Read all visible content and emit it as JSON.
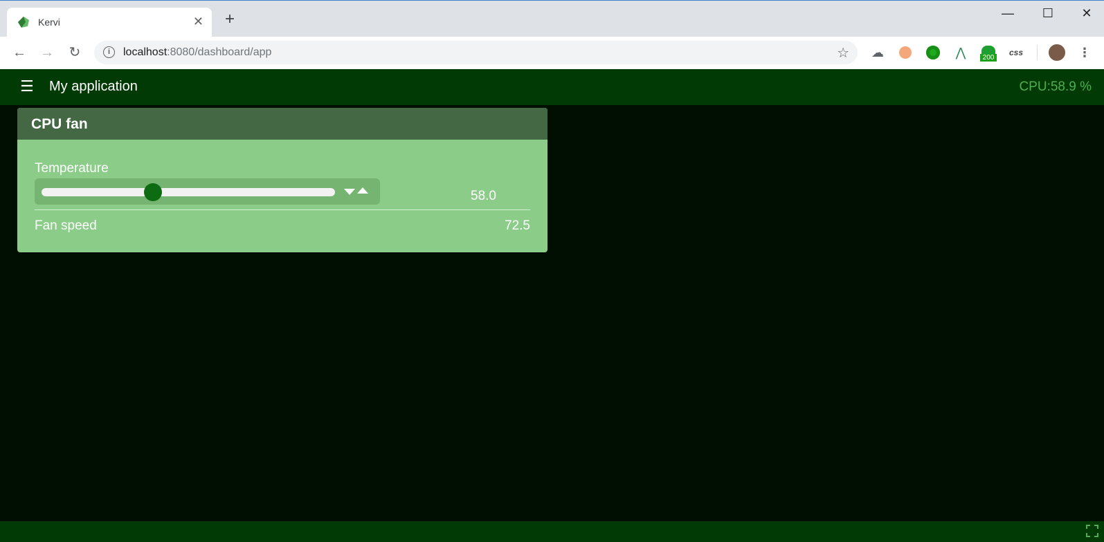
{
  "browser": {
    "tab_title": "Kervi",
    "tab_close": "✕",
    "new_tab": "+",
    "url_host": "localhost",
    "url_path": ":8080/dashboard/app",
    "controls": {
      "minimize": "—",
      "maximize": "☐",
      "close": "✕"
    },
    "extensions": {
      "badge": "200",
      "css": "css"
    }
  },
  "app": {
    "title": "My application",
    "cpu": "CPU:58.9 %"
  },
  "panel": {
    "title": "CPU fan",
    "temperature_label": "Temperature",
    "temperature_value": "58.0",
    "slider_fraction": 0.38,
    "fan_label": "Fan speed",
    "fan_value": "72.5"
  },
  "colors": {
    "header": "#023a06",
    "panel_head": "#436843",
    "panel_body": "#8bcd88",
    "thumb": "#0d6b12",
    "cpu_text": "#4caf50"
  }
}
